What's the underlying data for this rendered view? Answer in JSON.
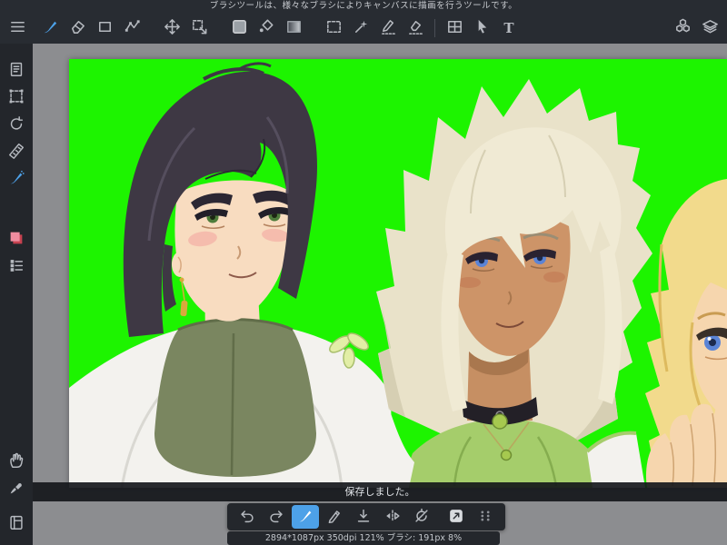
{
  "tooltip_bar": {
    "text": "ブラシツールは、様々なブラシによりキャンバスに描画を行うツールです。"
  },
  "toolbar": {
    "active_tool": "brush",
    "text_tool_label": "T",
    "tools": [
      "menu",
      "brush",
      "eraser",
      "shape",
      "polyline",
      "move",
      "transform",
      "color-swatch",
      "fill-bucket",
      "gradient",
      "select-rectangle",
      "magic-wand",
      "select-pen",
      "select-eraser",
      "panel-divide",
      "operation-cursor",
      "text",
      "material",
      "layers"
    ]
  },
  "sidebar": {
    "active_tool": "airbrush",
    "tools": [
      "pages",
      "select-area",
      "reset-view",
      "ruler",
      "airbrush",
      "color-palette",
      "layer-list",
      "hand",
      "eyedropper",
      "sub-panel"
    ]
  },
  "bottom_toolbar": {
    "active_tool": "brush",
    "tools": [
      "undo",
      "redo",
      "brush",
      "stylus",
      "save",
      "flip-view",
      "reset-rotation",
      "export",
      "drag-handle"
    ]
  },
  "toast": {
    "message": "保存しました。"
  },
  "status_bar": {
    "text": "2894*1087px 350dpi 121%  ブラシ: 191px 8%"
  },
  "colors": {
    "accent": "#4da1e8",
    "chroma_green": "#1df400",
    "toolbar_bg": "#282c32",
    "sidebar_bg": "#23262b",
    "workspace_gray": "#8c8d90"
  }
}
